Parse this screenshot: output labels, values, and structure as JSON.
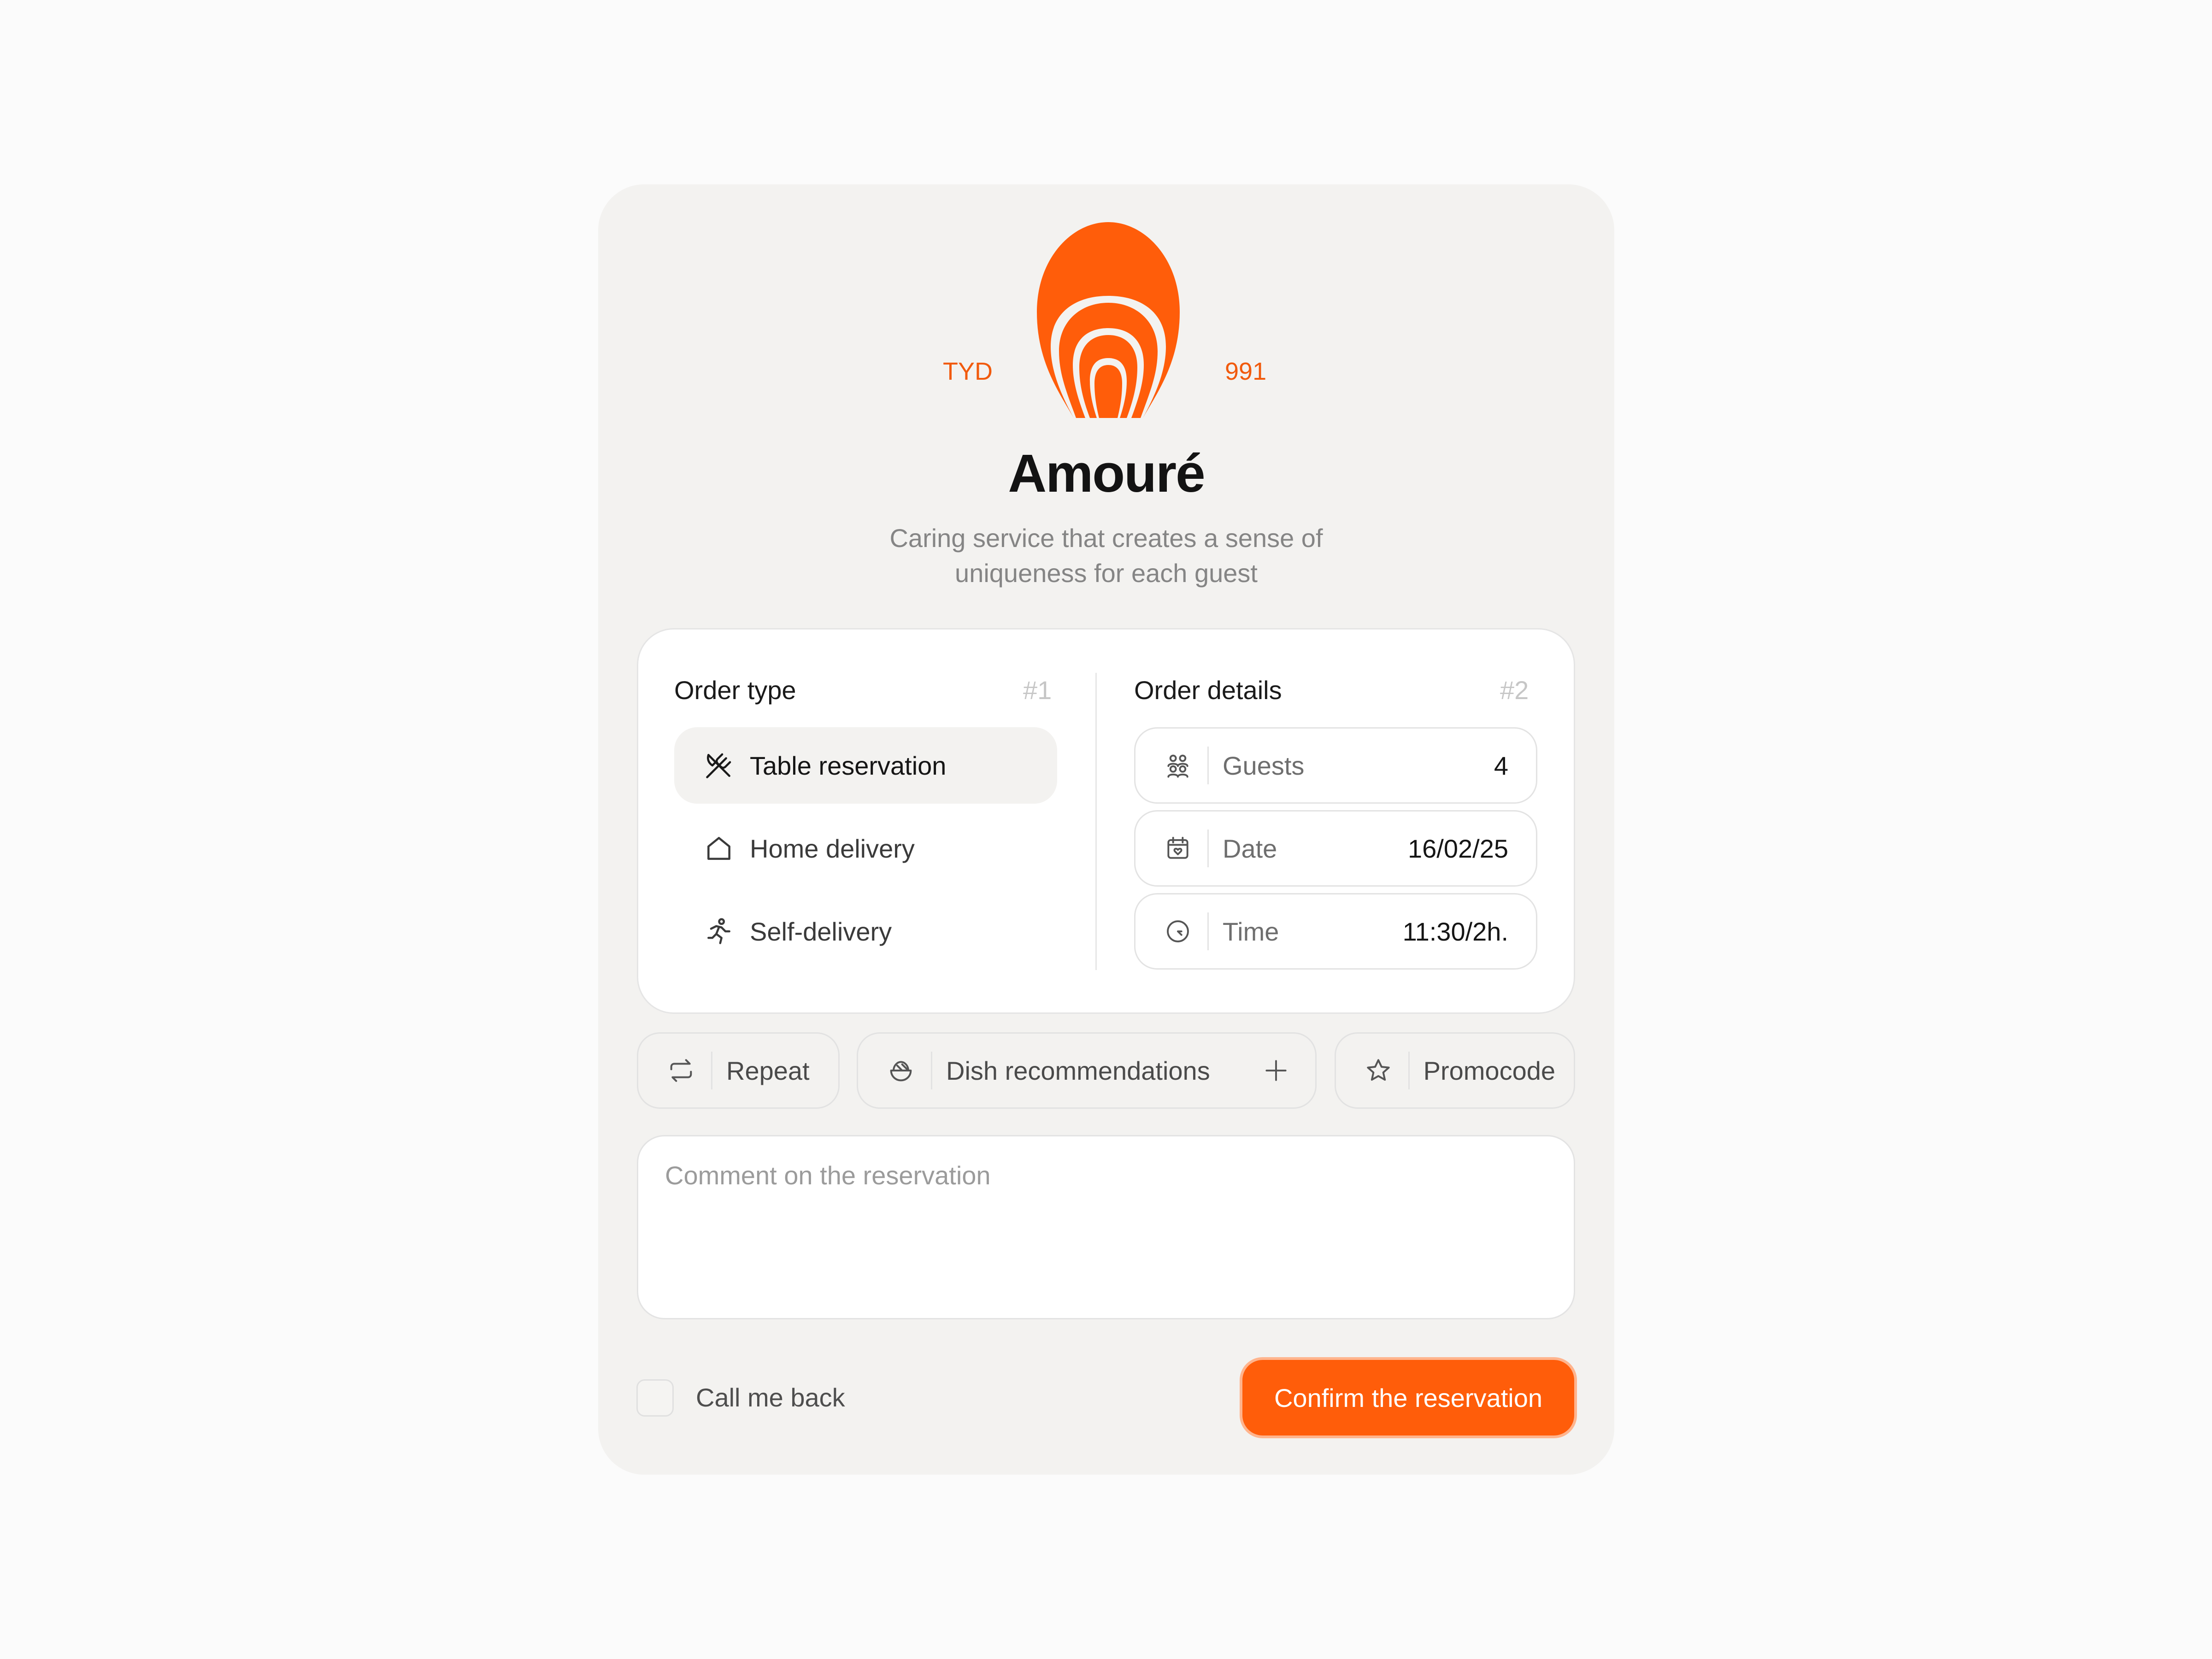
{
  "brand": {
    "left_code": "TYD",
    "right_code": "991",
    "name": "Amouré",
    "tagline_line1": "Caring service that creates a sense of",
    "tagline_line2": "uniqueness for each guest",
    "accent_color": "#ff5d0a"
  },
  "order_type": {
    "title": "Order type",
    "step": "#1",
    "options": [
      {
        "label": "Table reservation",
        "icon": "cutlery-icon",
        "selected": true
      },
      {
        "label": "Home delivery",
        "icon": "house-icon",
        "selected": false
      },
      {
        "label": "Self-delivery",
        "icon": "running-person-icon",
        "selected": false
      }
    ]
  },
  "order_details": {
    "title": "Order details",
    "step": "#2",
    "fields": [
      {
        "label": "Guests",
        "value": "4",
        "icon": "people-icon"
      },
      {
        "label": "Date",
        "value": "16/02/25",
        "icon": "calendar-heart-icon"
      },
      {
        "label": "Time",
        "value": "11:30/2h.",
        "icon": "clock-icon"
      }
    ]
  },
  "extras": {
    "repeat": {
      "label": "Repeat",
      "icon": "repeat-icon"
    },
    "dish": {
      "label": "Dish recommendations",
      "icon": "bowl-icon",
      "action_icon": "plus-icon"
    },
    "promo": {
      "label": "Promocode",
      "icon": "star-icon"
    }
  },
  "comment": {
    "placeholder": "Comment on the reservation",
    "value": ""
  },
  "callback": {
    "label": "Call me back",
    "checked": false
  },
  "confirm": {
    "label": "Confirm the reservation"
  }
}
